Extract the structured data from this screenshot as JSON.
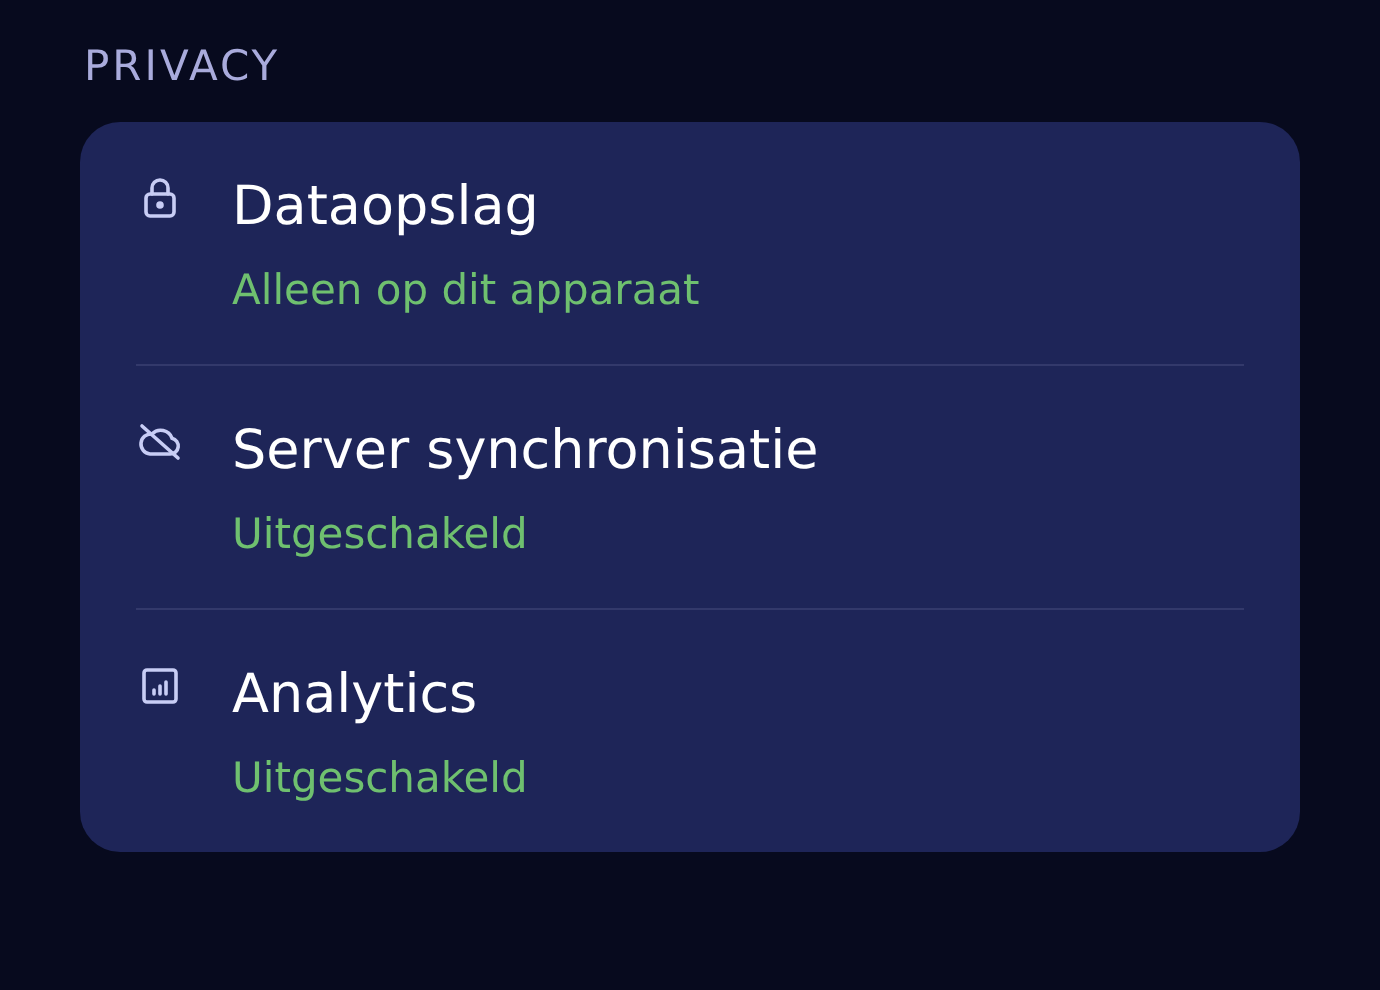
{
  "section": {
    "title": "PRIVACY"
  },
  "items": [
    {
      "kind": "lock",
      "title": "Dataopslag",
      "status": "Alleen op dit apparaat"
    },
    {
      "kind": "cloud-off",
      "title": "Server synchronisatie",
      "status": "Uitgeschakeld"
    },
    {
      "kind": "chart",
      "title": "Analytics",
      "status": "Uitgeschakeld"
    }
  ]
}
